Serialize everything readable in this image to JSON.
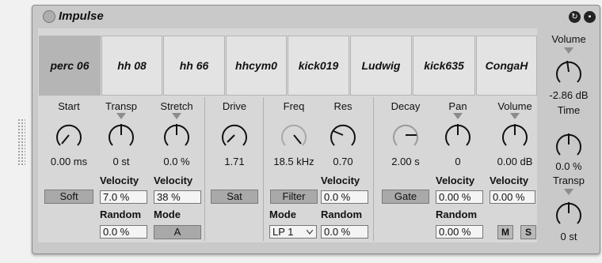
{
  "device": {
    "title": "Impulse",
    "icons": {
      "hotswap": "hotswap-icon",
      "save": "save-icon"
    }
  },
  "pads": [
    "perc 06",
    "hh 08",
    "hh 66",
    "hhcym0",
    "kick019",
    "Ludwig",
    "kick635",
    "CongaH"
  ],
  "start": {
    "label": "Start",
    "value": "0.00 ms",
    "button": "Soft"
  },
  "transp": {
    "label": "Transp",
    "value": "0 st",
    "vel_label": "Velocity",
    "vel_value": "7.0 %",
    "rand_label": "Random",
    "rand_value": "0.0 %"
  },
  "stretch": {
    "label": "Stretch",
    "value": "0.0 %",
    "vel_label": "Velocity",
    "vel_value": "38 %",
    "mode_label": "Mode",
    "mode_value": "A"
  },
  "drive": {
    "label": "Drive",
    "value": "1.71",
    "button": "Sat"
  },
  "freq": {
    "label": "Freq",
    "value": "18.5 kHz",
    "button": "Filter",
    "mode_label": "Mode",
    "mode_value": "LP 1"
  },
  "res": {
    "label": "Res",
    "value": "0.70",
    "vel_label": "Velocity",
    "vel_value": "0.0 %",
    "rand_label": "Random",
    "rand_value": "0.0 %"
  },
  "decay": {
    "label": "Decay",
    "value": "2.00 s",
    "button": "Gate"
  },
  "pan": {
    "label": "Pan",
    "value": "0",
    "vel_label": "Velocity",
    "vel_value": "0.00 %",
    "rand_label": "Random",
    "rand_value": "0.00 %"
  },
  "volume": {
    "label": "Volume",
    "value": "0.00 dB",
    "vel_label": "Velocity",
    "vel_value": "0.00 %",
    "mute": "M",
    "solo": "S"
  },
  "global": {
    "volume": {
      "label": "Volume",
      "value": "-2.86 dB"
    },
    "time": {
      "label": "Time",
      "value": "0.0 %"
    },
    "transp": {
      "label": "Transp",
      "value": "0 st"
    }
  },
  "colors": {
    "pad_selected": "#b5b5b5",
    "pad": "#e3e3e3",
    "button": "#a9a9a9"
  }
}
